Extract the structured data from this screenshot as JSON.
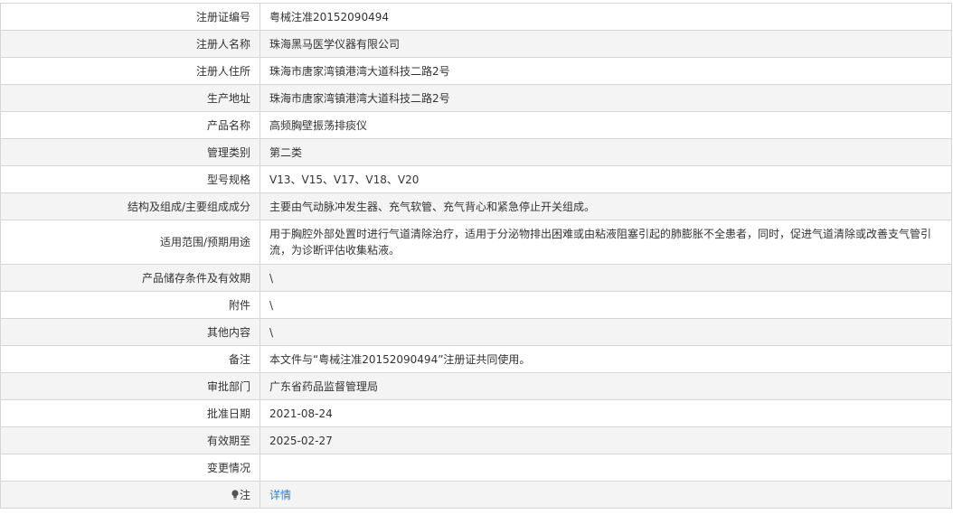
{
  "rows": [
    {
      "label": "注册证编号",
      "value": "粤械注准20152090494"
    },
    {
      "label": "注册人名称",
      "value": "珠海黑马医学仪器有限公司"
    },
    {
      "label": "注册人住所",
      "value": "珠海市唐家湾镇港湾大道科技二路2号"
    },
    {
      "label": "生产地址",
      "value": "珠海市唐家湾镇港湾大道科技二路2号"
    },
    {
      "label": "产品名称",
      "value": "高频胸壁振荡排痰仪"
    },
    {
      "label": "管理类别",
      "value": "第二类"
    },
    {
      "label": "型号规格",
      "value": "V13、V15、V17、V18、V20"
    },
    {
      "label": "结构及组成/主要组成成分",
      "value": "主要由气动脉冲发生器、充气软管、充气背心和紧急停止开关组成。"
    },
    {
      "label": "适用范围/预期用途",
      "value": "用于胸腔外部处置时进行气道清除治疗，适用于分泌物排出困难或由粘液阻塞引起的肺膨胀不全患者，同时，促进气道清除或改善支气管引流，为诊断评估收集粘液。"
    },
    {
      "label": "产品储存条件及有效期",
      "value": "\\"
    },
    {
      "label": "附件",
      "value": "\\"
    },
    {
      "label": "其他内容",
      "value": "\\"
    },
    {
      "label": "备注",
      "value": "本文件与“粤械注准20152090494”注册证共同使用。"
    },
    {
      "label": "审批部门",
      "value": "广东省药品监督管理局"
    },
    {
      "label": "批准日期",
      "value": "2021-08-24"
    },
    {
      "label": "有效期至",
      "value": "2025-02-27"
    },
    {
      "label": "变更情况",
      "value": ""
    }
  ],
  "note": {
    "icon": "lightbulb-icon",
    "label": "注",
    "link_text": "详情"
  }
}
